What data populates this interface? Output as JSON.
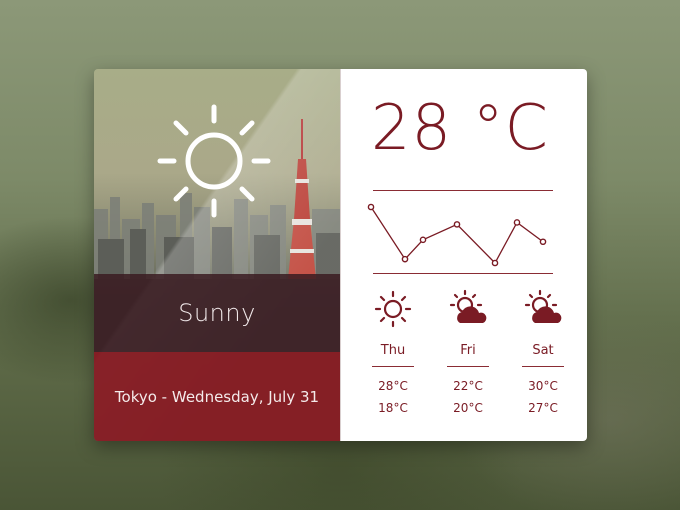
{
  "current": {
    "condition": "Sunny",
    "location_date": "Tokyo - Wednesday, July 31",
    "temperature": "28 °C",
    "icon": "sun-icon"
  },
  "trend_points": [
    65,
    38,
    48,
    56,
    36,
    57,
    47
  ],
  "forecast": [
    {
      "day": "Thu",
      "high": "28°C",
      "low": "18°C",
      "icon": "sun-icon"
    },
    {
      "day": "Fri",
      "high": "22°C",
      "low": "20°C",
      "icon": "partly-cloudy-icon"
    },
    {
      "day": "Sat",
      "high": "30°C",
      "low": "27°C",
      "icon": "partly-cloudy-icon"
    }
  ],
  "colors": {
    "accent": "#7a1b24",
    "band_dark": "#3a1c22",
    "band_red": "#8a1820"
  }
}
